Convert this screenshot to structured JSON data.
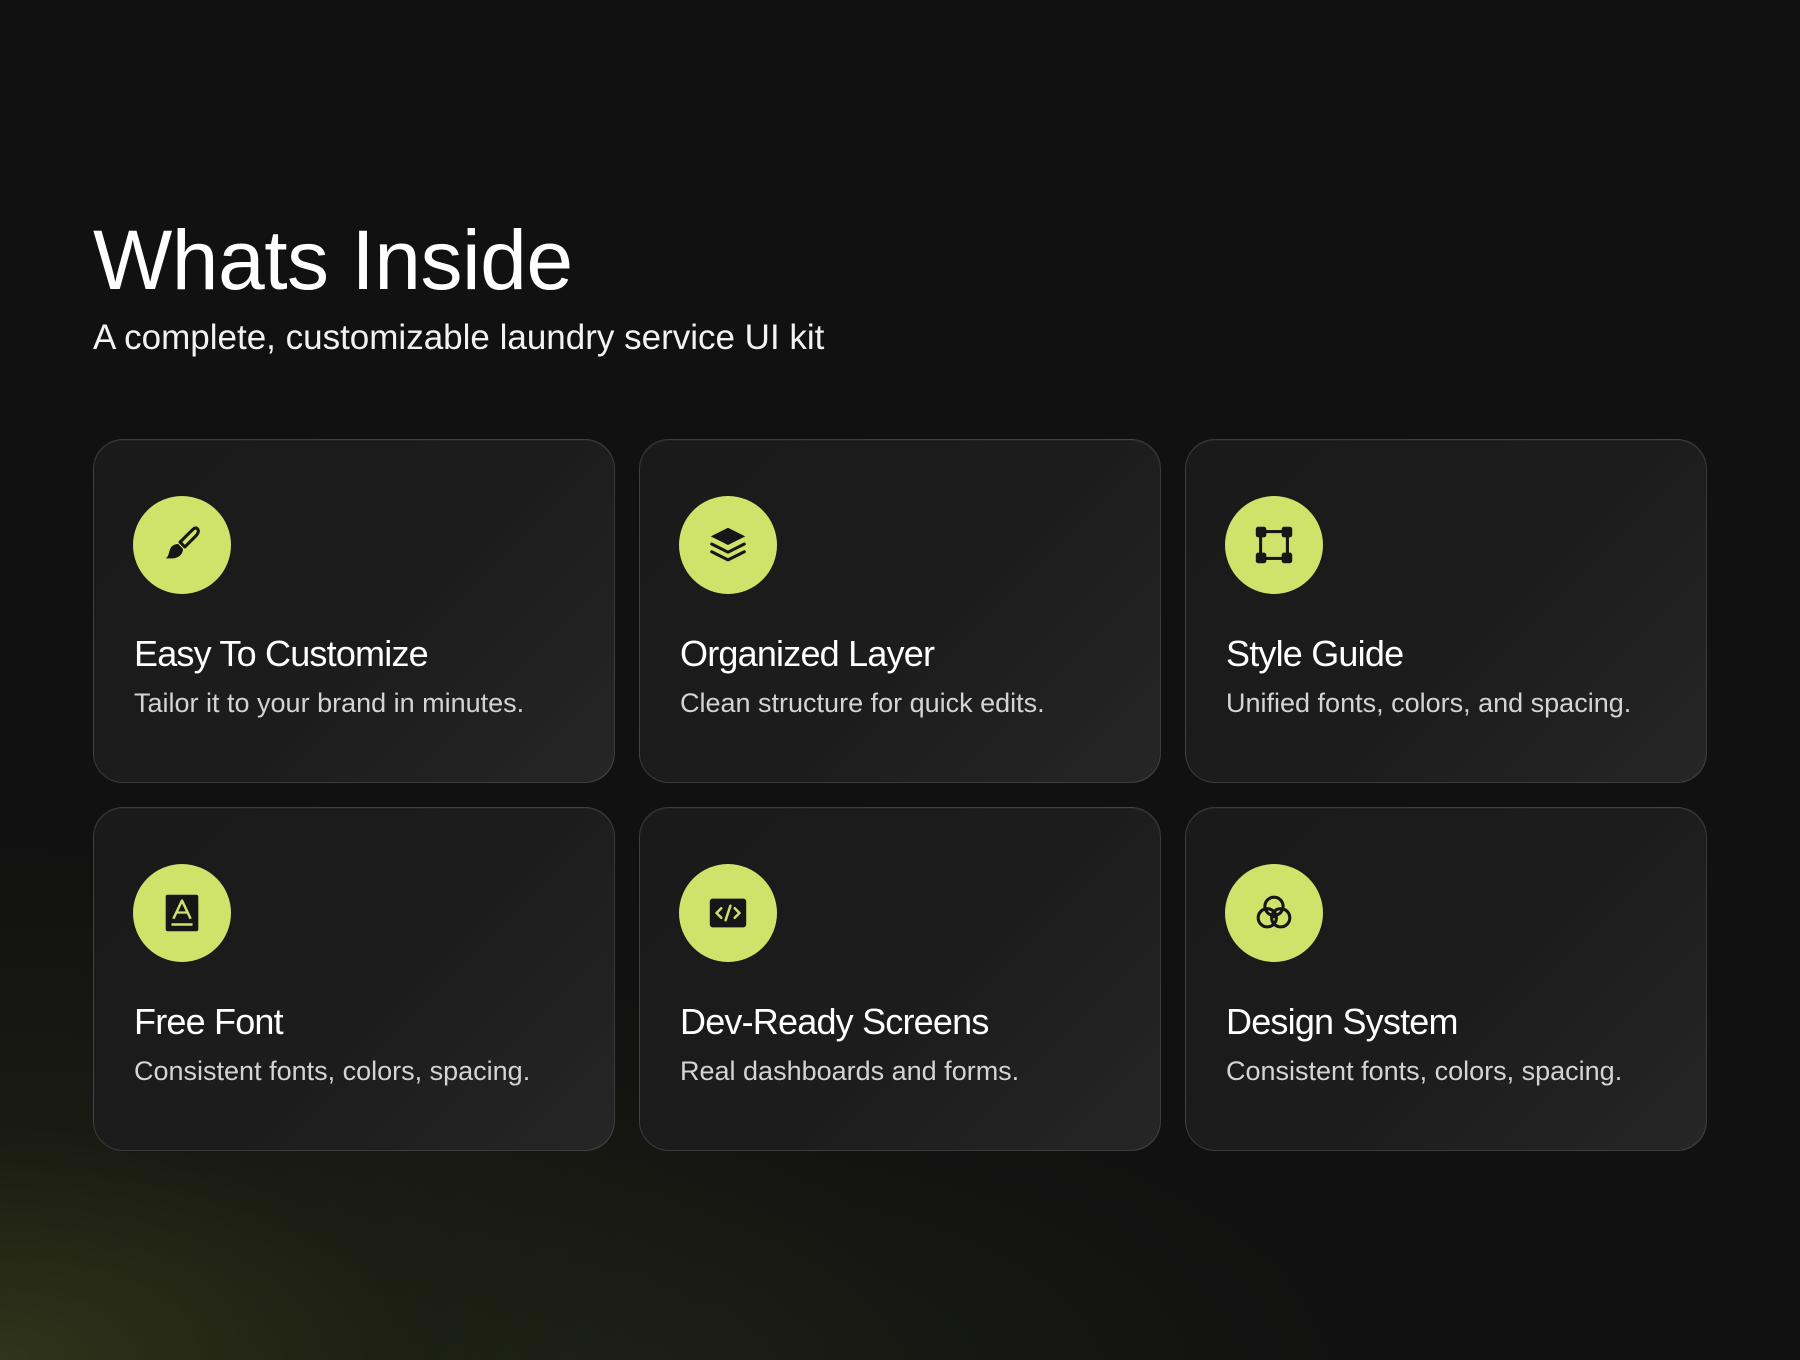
{
  "header": {
    "title": "Whats Inside",
    "subtitle": "A complete, customizable laundry service UI kit"
  },
  "theme": {
    "background": "#111111",
    "accent": "#cfe36b",
    "card_background": "#1c1c1c",
    "icon_color": "#161616"
  },
  "features": [
    {
      "icon": "paintbrush-icon",
      "title": "Easy To Customize",
      "description": "Tailor it to your brand in minutes."
    },
    {
      "icon": "layers-icon",
      "title": "Organized Layer",
      "description": "Clean structure for quick edits."
    },
    {
      "icon": "frame-nodes-icon",
      "title": "Style Guide",
      "description": "Unified fonts, colors, and spacing."
    },
    {
      "icon": "typography-icon",
      "title": "Free Font",
      "description": "Consistent fonts, colors, spacing."
    },
    {
      "icon": "code-icon",
      "title": "Dev-Ready Screens",
      "description": "Real dashboards and forms."
    },
    {
      "icon": "color-circles-icon",
      "title": "Design System",
      "description": "Consistent fonts, colors, spacing."
    }
  ]
}
